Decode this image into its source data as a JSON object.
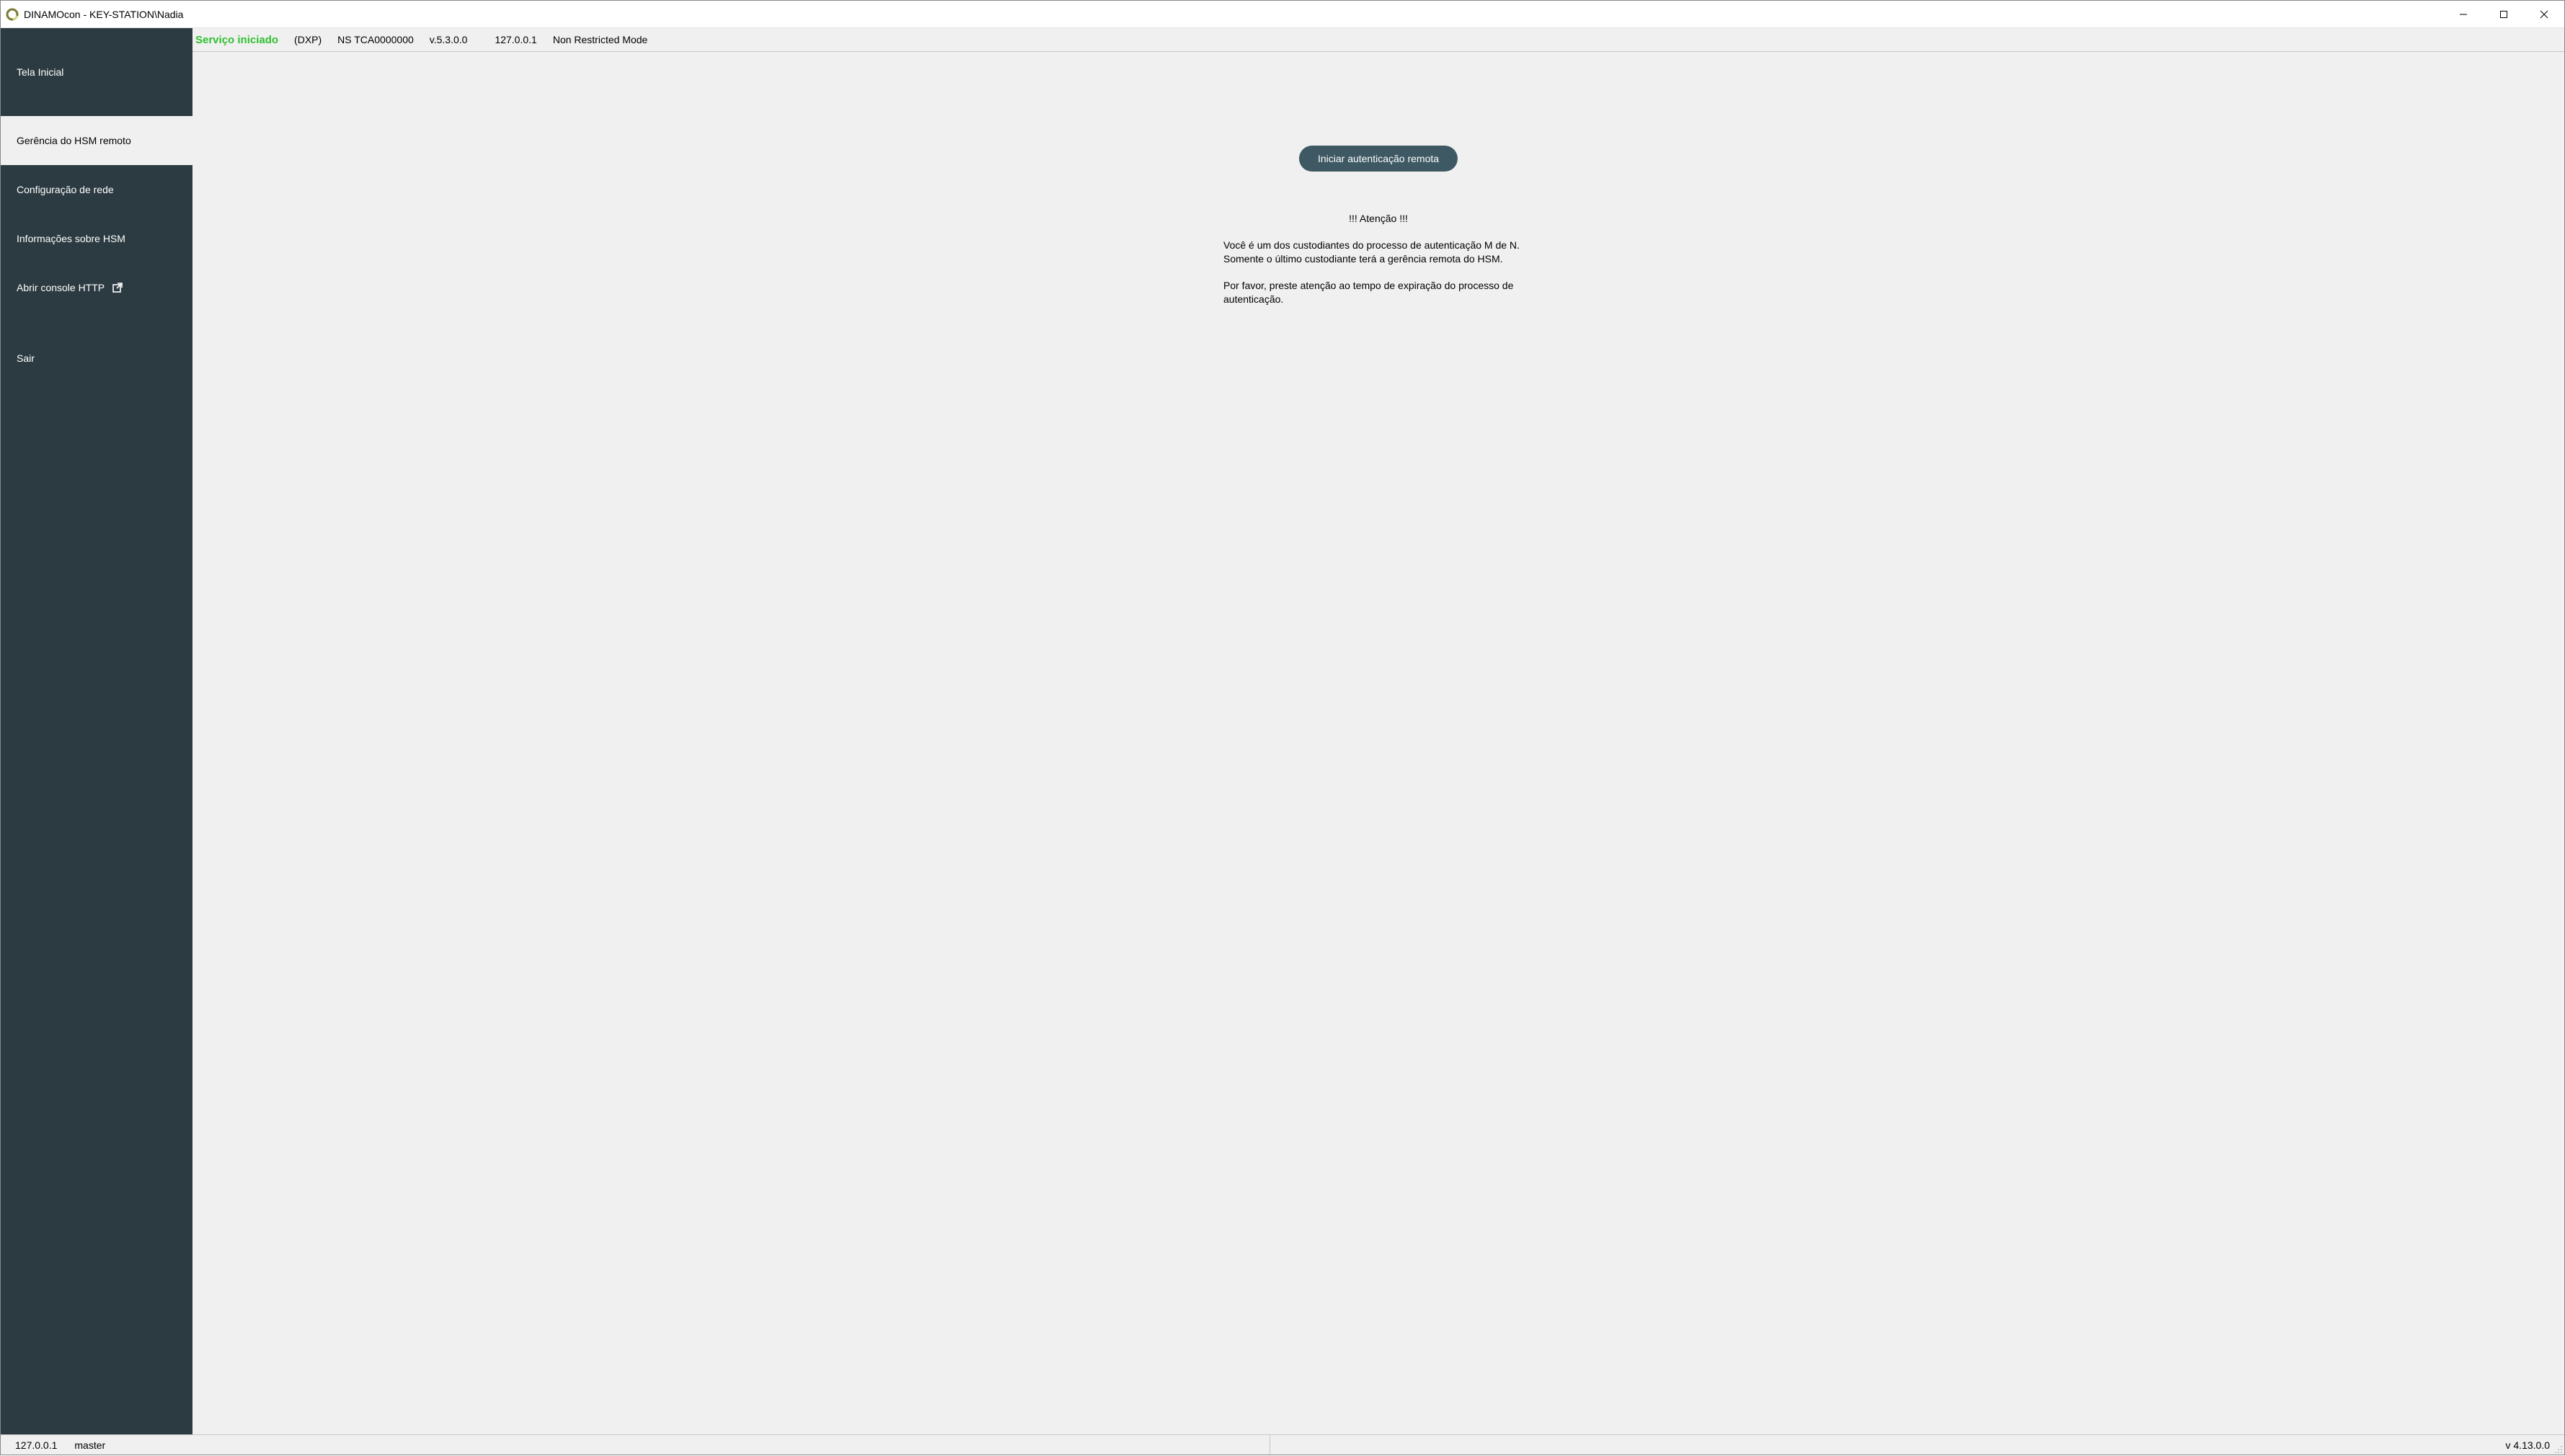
{
  "titlebar": {
    "title": "DINAMOcon - KEY-STATION\\Nadia"
  },
  "sidebar": {
    "items": [
      {
        "label": "Tela Inicial"
      },
      {
        "label": "Gerência do HSM remoto"
      },
      {
        "label": "Configuração de rede"
      },
      {
        "label": "Informações sobre HSM"
      },
      {
        "label": "Abrir console HTTP"
      },
      {
        "label": "Sair"
      }
    ]
  },
  "topbar": {
    "status": "Serviço iniciado",
    "model": "(DXP)",
    "serial": "NS TCA0000000",
    "version": "v.5.3.0.0",
    "ip": "127.0.0.1",
    "mode": "Non Restricted Mode"
  },
  "main": {
    "primary_button": "Iniciar autenticação remota",
    "warning_title": "!!! Atenção !!!",
    "para1": "Você é um dos custodiantes do processo de autenticação M de N. Somente o último custodiante terá a gerência remota do HSM.",
    "para2": "Por favor, preste atenção ao tempo de expiração do processo de autenticação."
  },
  "statusbar": {
    "ip": "127.0.0.1",
    "user": "master",
    "version": "v 4.13.0.0"
  }
}
